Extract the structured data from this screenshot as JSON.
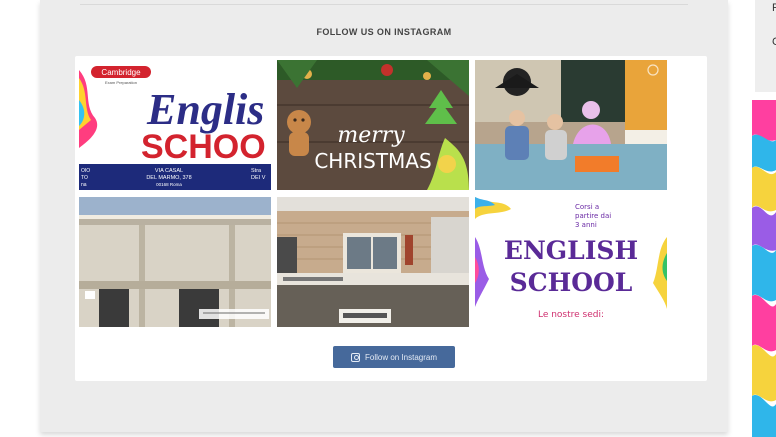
{
  "section": {
    "title": "FOLLOW US ON INSTAGRAM"
  },
  "posts": [
    {
      "badge": "Cambridge",
      "badge_sub": "Exam Preparation",
      "line1": "Englis",
      "line2": "SCHOO",
      "footer_left": [
        "OIO",
        "TO",
        "na"
      ],
      "footer_mid": [
        "VIA CASAL",
        "DEL MARMO, 378",
        "00168 Roma"
      ],
      "footer_right": [
        "Stra",
        "DEI V"
      ]
    },
    {
      "line1": "merry",
      "line2": "CHRISTMAS"
    },
    {},
    {},
    {},
    {
      "top_note": [
        "Corsi a",
        "partire dai",
        "3 anni"
      ],
      "line1": "ENGLISH",
      "line2": "SCHOOL",
      "bottom_note": "Le nostre sedi:"
    }
  ],
  "follow_button": {
    "label": "Follow on Instagram",
    "icon": "instagram-icon"
  },
  "right_panel": {
    "glyph1": "F",
    "glyph2": "C"
  },
  "colors": {
    "accent": "#46699b",
    "card_bg": "#ececec",
    "title": "#444444"
  }
}
